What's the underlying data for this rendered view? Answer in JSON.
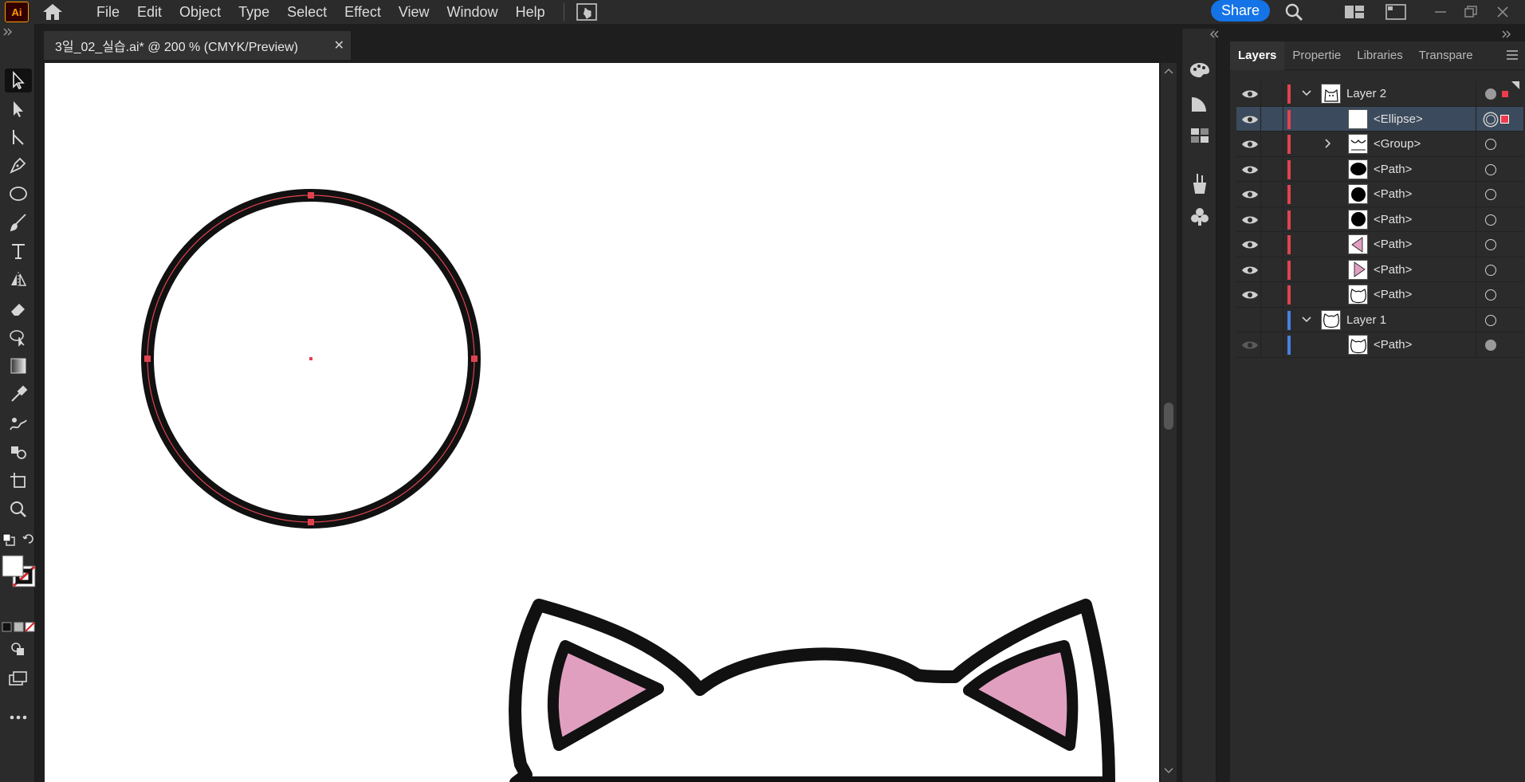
{
  "app": {
    "logo": "Ai",
    "menu": [
      "File",
      "Edit",
      "Object",
      "Type",
      "Select",
      "Effect",
      "View",
      "Window",
      "Help"
    ],
    "share_label": "Share"
  },
  "document": {
    "tab_title": "3일_02_실습.ai* @ 200 % (CMYK/Preview)",
    "close_glyph": "✕"
  },
  "panel": {
    "tabs": [
      "Layers",
      "Propertie",
      "Libraries",
      "Transpare"
    ],
    "active_tab": "Layers"
  },
  "layers": [
    {
      "name": "Layer 2",
      "indent": 0,
      "expand": "down",
      "color": "#e0434f",
      "eye": true,
      "thumb": "cat",
      "target": "filled",
      "selected": false,
      "selsq": "small"
    },
    {
      "name": "<Ellipse>",
      "indent": 1,
      "expand": "none",
      "color": "#e0434f",
      "eye": true,
      "thumb": "blank",
      "target": "double",
      "selected": true,
      "selsq": "big"
    },
    {
      "name": "<Group>",
      "indent": 1,
      "expand": "right",
      "color": "#e0434f",
      "eye": true,
      "thumb": "group",
      "target": "ring",
      "selected": false,
      "selsq": "none"
    },
    {
      "name": "<Path>",
      "indent": 1,
      "expand": "none",
      "color": "#e0434f",
      "eye": true,
      "thumb": "blob",
      "target": "ring",
      "selected": false,
      "selsq": "none"
    },
    {
      "name": "<Path>",
      "indent": 1,
      "expand": "none",
      "color": "#e0434f",
      "eye": true,
      "thumb": "dot",
      "target": "ring",
      "selected": false,
      "selsq": "none"
    },
    {
      "name": "<Path>",
      "indent": 1,
      "expand": "none",
      "color": "#e0434f",
      "eye": true,
      "thumb": "dot",
      "target": "ring",
      "selected": false,
      "selsq": "none"
    },
    {
      "name": "<Path>",
      "indent": 1,
      "expand": "none",
      "color": "#e0434f",
      "eye": true,
      "thumb": "pinkL",
      "target": "ring",
      "selected": false,
      "selsq": "none"
    },
    {
      "name": "<Path>",
      "indent": 1,
      "expand": "none",
      "color": "#e0434f",
      "eye": true,
      "thumb": "pinkR",
      "target": "ring",
      "selected": false,
      "selsq": "none"
    },
    {
      "name": "<Path>",
      "indent": 1,
      "expand": "none",
      "color": "#e0434f",
      "eye": true,
      "thumb": "head",
      "target": "ring",
      "selected": false,
      "selsq": "none"
    },
    {
      "name": "Layer 1",
      "indent": 0,
      "expand": "down",
      "color": "#4a7fe0",
      "eye": false,
      "thumb": "head",
      "target": "ring",
      "selected": false,
      "selsq": "none"
    },
    {
      "name": "<Path>",
      "indent": 1,
      "expand": "none",
      "color": "#4a7fe0",
      "eye": "dim",
      "thumb": "head",
      "target": "filled",
      "selected": false,
      "selsq": "none"
    }
  ],
  "colors": {
    "accent": "#1473e6",
    "selection": "#e0434f",
    "ear_pink": "#e19fc0"
  }
}
